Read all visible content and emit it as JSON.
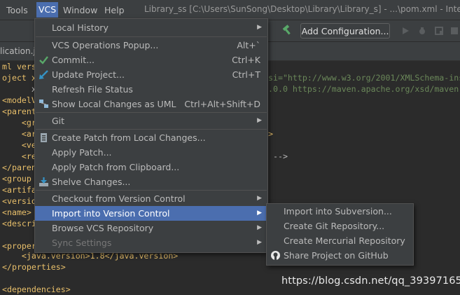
{
  "menubar": {
    "items": [
      "Tools",
      "VCS",
      "Window",
      "Help"
    ],
    "window_title": "Library_ss [C:\\Users\\SunSong\\Desktop\\Library\\Library_s] - ...\\pom.xml - IntelliJ"
  },
  "toolbar": {
    "add_configuration_label": "Add Configuration..."
  },
  "tab": {
    "label": "lication.j"
  },
  "editor": {
    "lines": [
      "ml versi",
      "oject xm",
      "      xs",
      "<modelV",
      "<parent",
      "    <gr",
      "    <ar",
      "    <ve",
      "    <re",
      "</paren",
      "<group",
      "<artifa",
      "<versio",
      "<name>",
      "<descri",
      "",
      "<proper",
      "    <java.version>1.8</java.version>",
      "</properties>",
      "",
      "<dependencies>"
    ],
    "right_fragments": {
      "xsi_attr": "si=\"http://www.w3.org/2001/XMLSchema-ins",
      "schema_loc": ".0.0 https://maven.apache.org/xsd/maven",
      "close_tag": ">",
      "comment_end": "-->"
    }
  },
  "vcs_menu": {
    "items": [
      {
        "label": "Local History",
        "shortcut": "",
        "submenu": true
      },
      {
        "label": "VCS Operations Popup...",
        "shortcut": "Alt+`",
        "submenu": false
      },
      {
        "label": "Commit...",
        "shortcut": "Ctrl+K",
        "icon": "check-icon"
      },
      {
        "label": "Update Project...",
        "shortcut": "Ctrl+T",
        "icon": "update-arrow-icon"
      },
      {
        "label": "Refresh File Status",
        "shortcut": ""
      },
      {
        "label": "Show Local Changes as UML",
        "shortcut": "Ctrl+Alt+Shift+D",
        "icon": "uml-icon"
      },
      {
        "label": "Git",
        "shortcut": "",
        "submenu": true
      },
      {
        "label": "Create Patch from Local Changes...",
        "shortcut": "",
        "icon": "patch-icon"
      },
      {
        "label": "Apply Patch...",
        "shortcut": ""
      },
      {
        "label": "Apply Patch from Clipboard...",
        "shortcut": ""
      },
      {
        "label": "Shelve Changes...",
        "shortcut": "",
        "icon": "shelve-icon"
      },
      {
        "label": "Checkout from Version Control",
        "shortcut": "",
        "submenu": true
      },
      {
        "label": "Import into Version Control",
        "shortcut": "",
        "submenu": true,
        "selected": true
      },
      {
        "label": "Browse VCS Repository",
        "shortcut": "",
        "submenu": true
      },
      {
        "label": "Sync Settings",
        "shortcut": "",
        "submenu": true,
        "disabled": true
      }
    ]
  },
  "import_submenu": {
    "items": [
      {
        "label": "Import into Subversion..."
      },
      {
        "label": "Create Git Repository..."
      },
      {
        "label": "Create Mercurial Repository"
      },
      {
        "label": "Share Project on GitHub",
        "icon": "github-icon"
      }
    ]
  },
  "watermark": "https://blog.csdn.net/qq_39397165",
  "colors": {
    "menu_bg": "#3c3f41",
    "selection": "#4b6eaf",
    "editor_bg": "#2b2b2b",
    "xml_tag": "#e8bf6a",
    "xml_string": "#6a8759"
  }
}
